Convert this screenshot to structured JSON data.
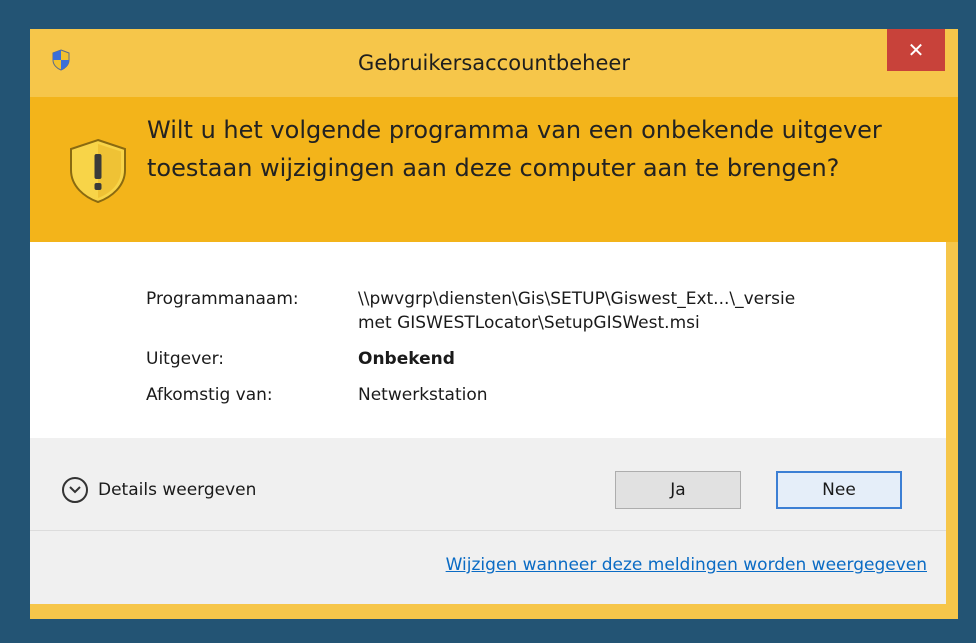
{
  "window": {
    "title": "Gebruikersaccountbeheer",
    "close_label": "✕"
  },
  "header": {
    "question": "Wilt u het volgende programma van een onbekende uitgever toestaan wijzigingen aan deze computer aan te brengen?"
  },
  "info": {
    "program_label": "Programmanaam:",
    "program_value_line1": "\\\\pwvgrp\\diensten\\Gis\\SETUP\\Giswest_Ext...\\_versie",
    "program_value_line2": "met GISWESTLocator\\SetupGISWest.msi",
    "publisher_label": "Uitgever:",
    "publisher_value": "Onbekend",
    "origin_label": "Afkomstig van:",
    "origin_value": "Netwerkstation"
  },
  "footer": {
    "details_label": "Details weergeven",
    "yes_label": "Ja",
    "no_label": "Nee",
    "change_link": "Wijzigen wanneer deze meldingen worden weergegeven"
  },
  "colors": {
    "desktop": "#235474",
    "titlebar": "#f6c64a",
    "header": "#f3b41a",
    "close": "#c8423a",
    "link": "#0a6bc4"
  },
  "icons": {
    "title": "uac-shield-icon",
    "header": "warning-shield-icon",
    "details": "chevron-down-icon"
  }
}
